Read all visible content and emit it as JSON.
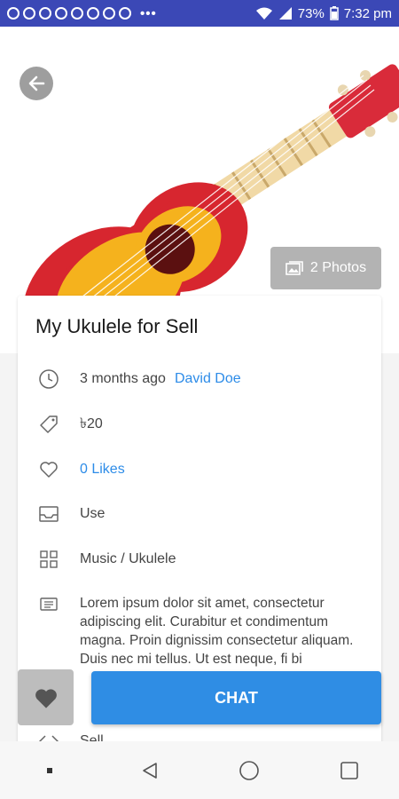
{
  "status_bar": {
    "battery": "73%",
    "time": "7:32 pm",
    "dots": "•••"
  },
  "listing": {
    "title": "My Ukulele for Sell",
    "posted": "3 months ago",
    "seller": "David Doe",
    "price": "৳20",
    "likes": "0 Likes",
    "condition": "Use",
    "category": "Music / Ukulele",
    "description": "Lorem ipsum dolor sit amet, consectetur adipiscing elit. Curabitur et condimentum magna. Proin dignissim consectetur aliquam. Duis nec mi tellus. Ut est neque, fi bi",
    "type": "Sell",
    "photos_label": "2 Photos"
  },
  "actions": {
    "chat_label": "CHAT"
  },
  "colors": {
    "status_bar": "#3b48b6",
    "accent": "#2f8de4",
    "link": "#2d8ce8"
  },
  "icons": [
    "back-arrow-icon",
    "photo-icon",
    "clock-icon",
    "tag-icon",
    "heart-icon",
    "inbox-icon",
    "grid-icon",
    "message-icon",
    "code-icon",
    "heart-filled-icon",
    "nav-back-icon",
    "nav-home-icon",
    "nav-recents-icon"
  ]
}
